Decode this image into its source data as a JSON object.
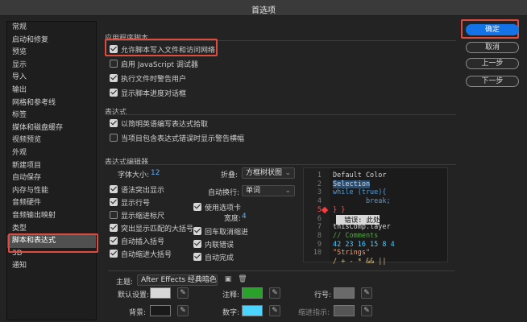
{
  "window": {
    "title": "首选项"
  },
  "sidebar": {
    "items": [
      "常规",
      "启动和修复",
      "预览",
      "显示",
      "导入",
      "输出",
      "网格和参考线",
      "标签",
      "媒体和磁盘缓存",
      "视频预览",
      "外观",
      "新建项目",
      "自动保存",
      "内存与性能",
      "音频硬件",
      "音频输出映射",
      "类型",
      "脚本和表达式",
      "3D",
      "通知"
    ],
    "selected_index": 17
  },
  "app_scripts": {
    "title": "应用程序脚本",
    "options": [
      {
        "label": "允许脚本写入文件和访问网络",
        "checked": true
      },
      {
        "label": "启用 JavaScript 调试器",
        "checked": false
      },
      {
        "label": "执行文件时警告用户",
        "checked": true
      },
      {
        "label": "显示脚本进度对话框",
        "checked": true
      }
    ]
  },
  "expressions": {
    "title": "表达式",
    "options": [
      {
        "label": "以简明英语编写表达式拾取",
        "checked": true
      },
      {
        "label": "当项目包含表达式错误时显示警告横幅",
        "checked": false
      }
    ]
  },
  "editor": {
    "title": "表达式编辑器",
    "font_size_label": "字体大小:",
    "font_size_value": "12",
    "fold_label": "折叠:",
    "fold_value": "方框树状图",
    "wrap_label": "自动换行:",
    "wrap_value": "单词",
    "use_tabs_label": "使用选项卡",
    "tab_width_label": "宽度:",
    "tab_width_value": "4",
    "left_options": [
      {
        "label": "语法突出显示",
        "checked": true
      },
      {
        "label": "显示行号",
        "checked": true
      },
      {
        "label": "显示缩进标尺",
        "checked": false
      },
      {
        "label": "突出显示匹配的大括号",
        "checked": true
      },
      {
        "label": "自动插入括号",
        "checked": true
      },
      {
        "label": "自动缩进大括号",
        "checked": true
      }
    ],
    "right_options": [
      {
        "label": "使用选项卡",
        "checked": true
      },
      {
        "label": "回车取消缩进",
        "checked": true
      },
      {
        "label": "内联错误",
        "checked": true
      },
      {
        "label": "自动完成",
        "checked": true
      }
    ]
  },
  "code_preview": {
    "line_numbers": [
      "1",
      "2",
      "3",
      "4",
      "5",
      "6",
      "7",
      "8",
      "9",
      "10"
    ],
    "lines": [
      {
        "text": "Default Color",
        "color": "#d4d4d4"
      },
      {
        "text": "Selection",
        "color": "#d4d4d4"
      },
      {
        "text": "while (true){",
        "color": "#569cd6"
      },
      {
        "text": "        break;",
        "color": "#569cd6"
      },
      {
        "text": "} }",
        "color": "#ff5555"
      },
      {
        "text": "  错误: 此处",
        "color": "#ffffff"
      },
      {
        "text": "thisComp.layer",
        "color": "#d4d4d4"
      },
      {
        "text": "// Comments",
        "color": "#57a64a"
      },
      {
        "text": "42 23 16 15 8 4",
        "color": "#4ec9ff"
      },
      {
        "text": "\"Strings\"",
        "color": "#ff9a66"
      },
      {
        "text": "/ + - * && ||",
        "color": "#d7ba7d"
      }
    ]
  },
  "theme": {
    "label": "主题:",
    "value": "After Effects 经典暗色",
    "default_label": "默认设置:",
    "background_label": "背景:",
    "comment_label": "注释:",
    "number_label": "数字:",
    "line_number_label": "行号:",
    "indent_guide_label": "缩进指示:",
    "colors": {
      "default": "#d8d8d8",
      "background": "#1a1a1a",
      "comment": "#2aa12a",
      "number": "#4ad4ff",
      "line_number": "#6a6a6a",
      "indent_guide": "#555555"
    }
  },
  "buttons": {
    "ok": "确定",
    "cancel": "取消",
    "prev": "上一步",
    "next": "下一步"
  }
}
